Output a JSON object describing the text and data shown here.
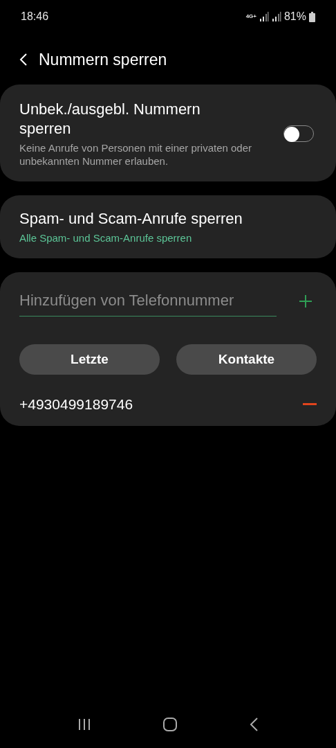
{
  "status_bar": {
    "time": "18:46",
    "network": "4G+",
    "battery": "81%"
  },
  "header": {
    "title": "Nummern sperren"
  },
  "settings": [
    {
      "title": "Unbek./ausgebl. Nummern sperren",
      "description": "Keine Anrufe von Personen mit einer privaten oder unbekannten Nummer erlauben.",
      "kind": "toggle",
      "on": false
    },
    {
      "title": "Spam- und Scam-Anrufe sperren",
      "description": "Alle Spam- und Scam-Anrufe sperren",
      "kind": "link"
    }
  ],
  "add_number": {
    "placeholder": "Hinzufügen von Telefonnummer",
    "buttons": [
      "Letzte",
      "Kontakte"
    ]
  },
  "blocked_numbers": [
    "+4930499189746"
  ]
}
